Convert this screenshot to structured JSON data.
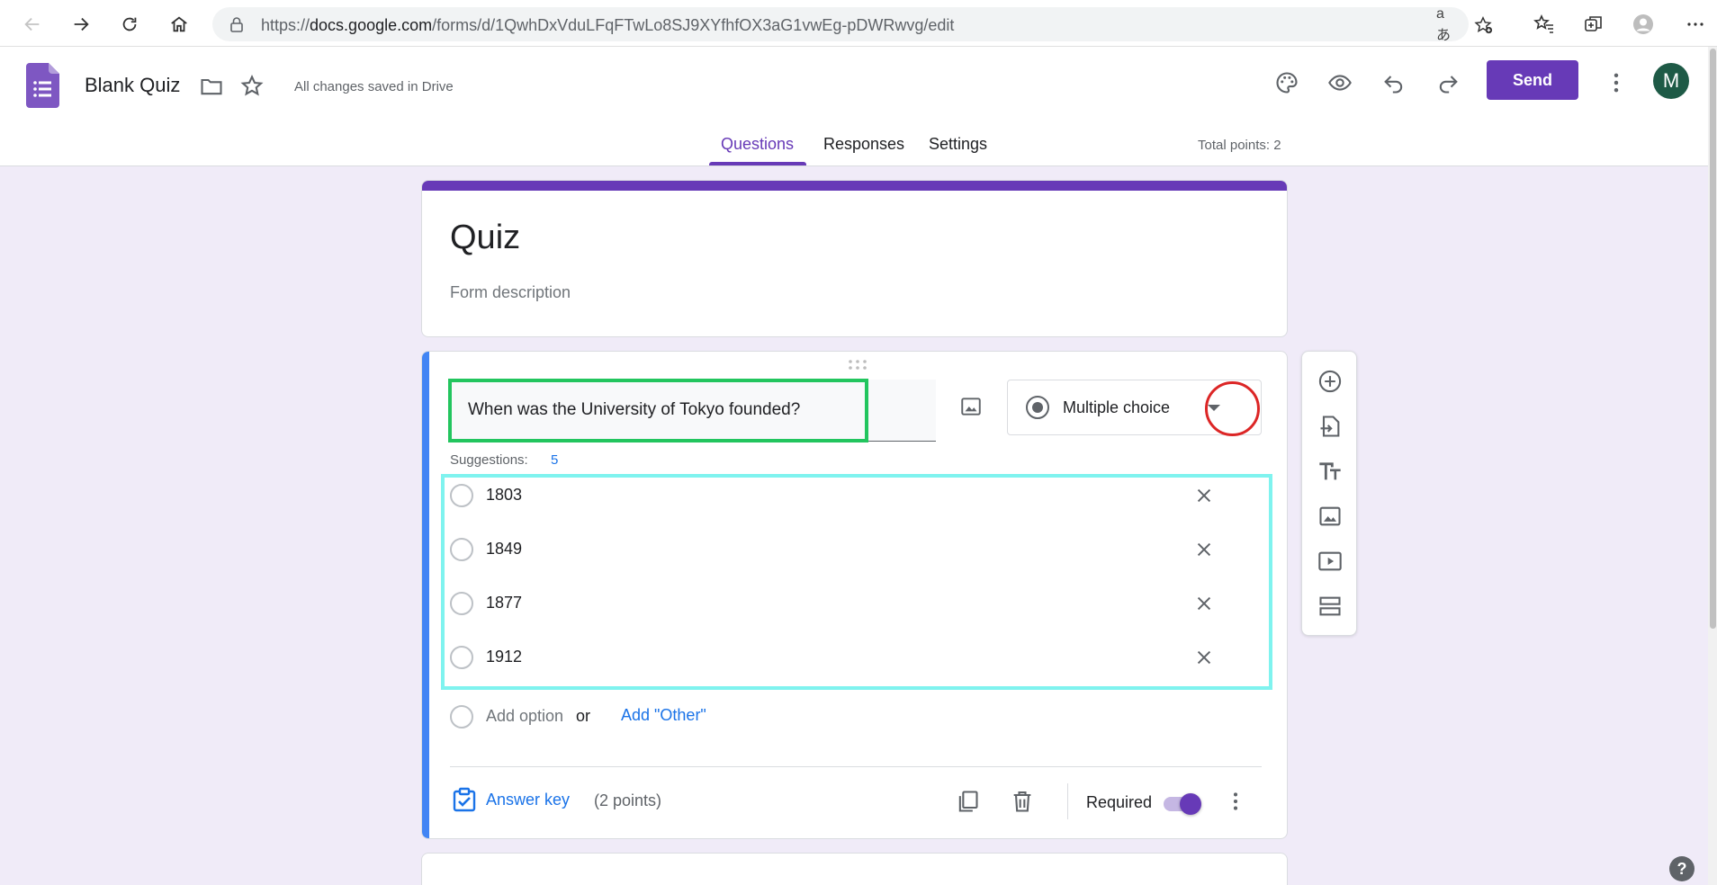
{
  "browser": {
    "url_prefix": "https://",
    "url_host": "docs.google.com",
    "url_path": "/forms/d/1QwhDxVduLFqFTwLo8SJ9XYfhfOX3aG1vwEg-pDWRwvg/edit",
    "read_aloud_glyph": "aあ"
  },
  "header": {
    "doc_title": "Blank Quiz",
    "saved_status": "All changes saved in Drive",
    "send_label": "Send",
    "avatar_initial": "M",
    "accent_color": "#673ab7"
  },
  "tabs": [
    {
      "label": "Questions",
      "active": true
    },
    {
      "label": "Responses",
      "active": false
    },
    {
      "label": "Settings",
      "active": false
    }
  ],
  "total_points": "Total points: 2",
  "form": {
    "title": "Quiz",
    "description_placeholder": "Form description"
  },
  "question": {
    "text": "When was the University of Tokyo founded?",
    "type": "Multiple choice",
    "suggestions_label": "Suggestions:",
    "suggestions_count": "5",
    "options": [
      {
        "label": "1803"
      },
      {
        "label": "1849"
      },
      {
        "label": "1877"
      },
      {
        "label": "1912"
      }
    ],
    "add_option": "Add option",
    "or": "or",
    "add_other": "Add \"Other\"",
    "answer_key": "Answer key",
    "points": "(2 points)",
    "required_label": "Required",
    "required": true
  },
  "help_glyph": "?"
}
